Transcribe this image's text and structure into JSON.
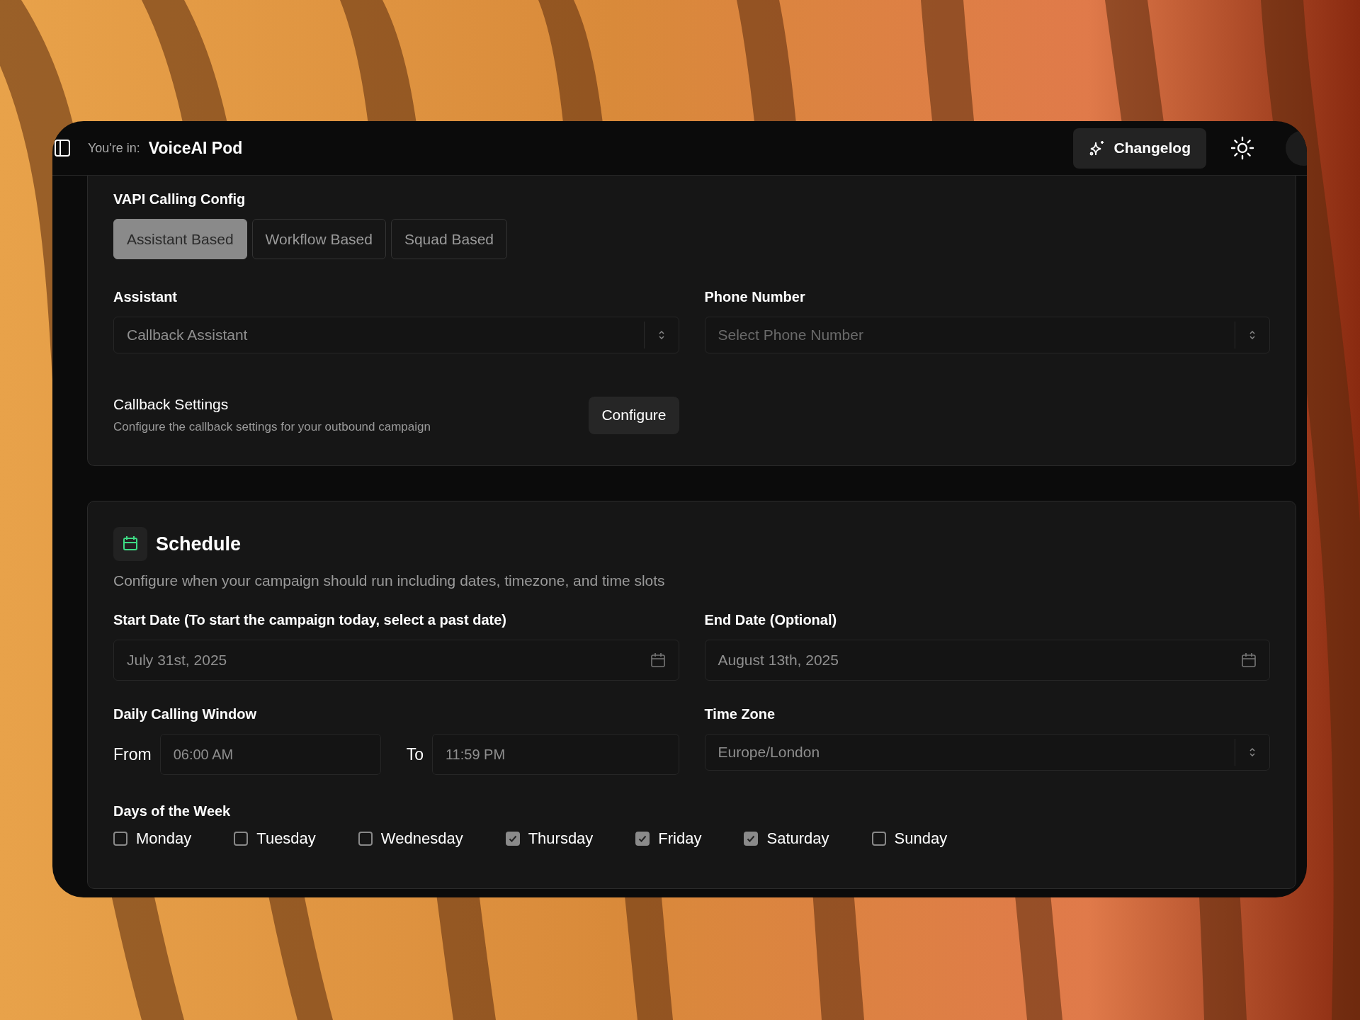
{
  "header": {
    "prefix": "You're in:",
    "workspace": "VoiceAI Pod",
    "changelog": "Changelog"
  },
  "vapi": {
    "title": "VAPI Calling Config",
    "options": [
      {
        "label": "Assistant Based",
        "selected": true
      },
      {
        "label": "Workflow Based",
        "selected": false
      },
      {
        "label": "Squad Based",
        "selected": false
      }
    ],
    "assistant": {
      "label": "Assistant",
      "value": "Callback Assistant"
    },
    "phone": {
      "label": "Phone Number",
      "placeholder": "Select Phone Number"
    },
    "callback": {
      "title": "Callback Settings",
      "description": "Configure the callback settings for your outbound campaign",
      "button": "Configure"
    }
  },
  "schedule": {
    "title": "Schedule",
    "description": "Configure when your campaign should run including dates, timezone, and time slots",
    "start_date": {
      "label": "Start Date (To start the campaign today, select a past date)",
      "value": "July 31st, 2025"
    },
    "end_date": {
      "label": "End Date (Optional)",
      "value": "August 13th, 2025"
    },
    "window": {
      "label": "Daily Calling Window",
      "from_label": "From",
      "from_value": "06:00 AM",
      "to_label": "To",
      "to_value": "11:59 PM"
    },
    "time_zone": {
      "label": "Time Zone",
      "value": "Europe/London"
    },
    "days": {
      "label": "Days of the Week",
      "items": [
        {
          "label": "Monday",
          "checked": false
        },
        {
          "label": "Tuesday",
          "checked": false
        },
        {
          "label": "Wednesday",
          "checked": false
        },
        {
          "label": "Thursday",
          "checked": true
        },
        {
          "label": "Friday",
          "checked": true
        },
        {
          "label": "Saturday",
          "checked": true
        },
        {
          "label": "Sunday",
          "checked": false
        }
      ]
    }
  }
}
